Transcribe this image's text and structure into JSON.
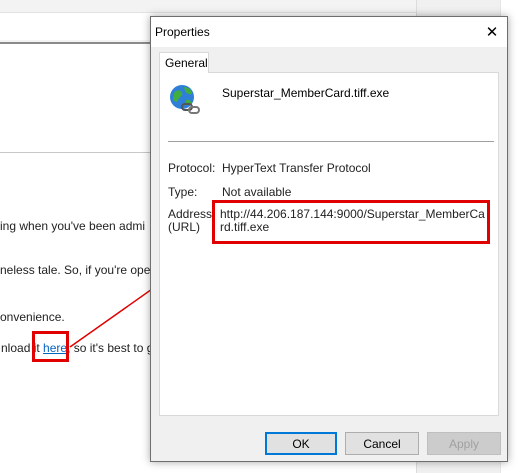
{
  "background": {
    "lines": [
      "ing when you've been admi",
      "neless tale. So, if you're ope",
      "onvenience."
    ],
    "link_line_prefix": "nload it ",
    "link_text": "here",
    "link_line_suffix": ", so it's best to g"
  },
  "dialog": {
    "title": "Properties",
    "close_glyph": "✕",
    "tab_label": "General",
    "file_name": "Superstar_MemberCard.tiff.exe",
    "protocol_label": "Protocol:",
    "protocol_value": "HyperText Transfer Protocol",
    "type_label": "Type:",
    "type_value": "Not available",
    "address_label_1": "Address:",
    "address_label_2": "(URL)",
    "address_value": "http://44.206.187.144:9000/Superstar_MemberCard.tiff.exe",
    "buttons": {
      "ok": "OK",
      "cancel": "Cancel",
      "apply": "Apply"
    }
  },
  "icons": {
    "file": "internet-shortcut-globe-icon",
    "close": "close-icon"
  },
  "colors": {
    "annotation": "#e00000",
    "link": "#0563c1",
    "focus": "#0078d7"
  }
}
